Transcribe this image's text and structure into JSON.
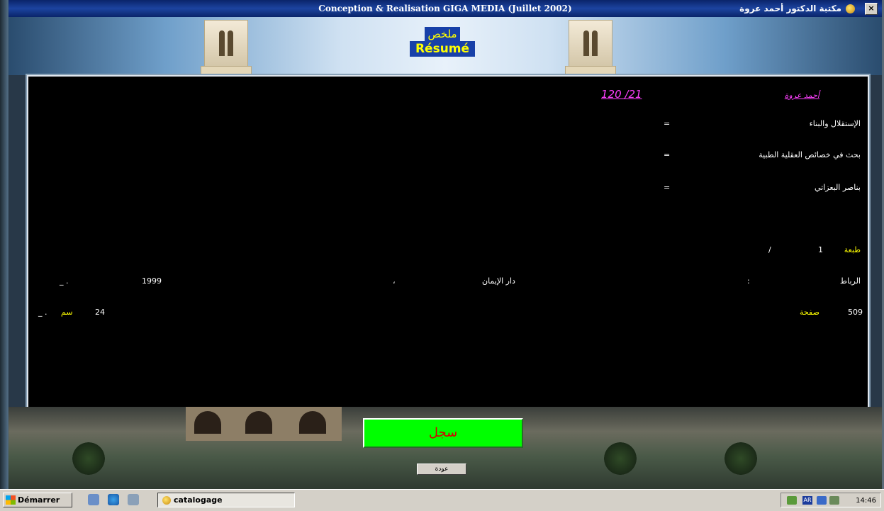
{
  "window": {
    "title": "Conception & Realisation GIGA MEDIA (Juillet 2002)",
    "app_name": "مكتبة الدكتور أحمد عروة",
    "close_label": "×"
  },
  "banner": {
    "title_ar": "ملخص",
    "title_fr": "Résumé"
  },
  "record": {
    "number": "120 /21",
    "author": "أحمد عروة",
    "subjects": [
      {
        "label": "الإستقلال والبناء",
        "mark": "="
      },
      {
        "label": "بحث في خصائص العقلية الطبية",
        "mark": "="
      },
      {
        "label": "بناصر البعزاتي",
        "mark": "="
      }
    ],
    "edition_label": "طبعة",
    "edition_value": "1",
    "edition_sep": "/",
    "city": "الرباط",
    "city_sep": ":",
    "publisher": "دار الإيمان",
    "publisher_sep": "،",
    "year": "1999",
    "year_sep": "_ .",
    "pages_value": "509",
    "pages_label": "صفحة",
    "size_value": "24",
    "size_label": "سم",
    "size_sep": "_ ."
  },
  "buttons": {
    "save_label": "سجل",
    "back_label": "عودة"
  },
  "taskbar": {
    "start_label": "Démarrer",
    "task_label": "catalogage",
    "lang": "AR",
    "clock": "14:46"
  },
  "colors": {
    "panel_bg": "#000000",
    "label_yellow": "#ffff00",
    "accent_magenta": "#ff40ff",
    "save_green": "#00ff00",
    "save_text": "#d40000",
    "titlebar": "#0a246a"
  }
}
